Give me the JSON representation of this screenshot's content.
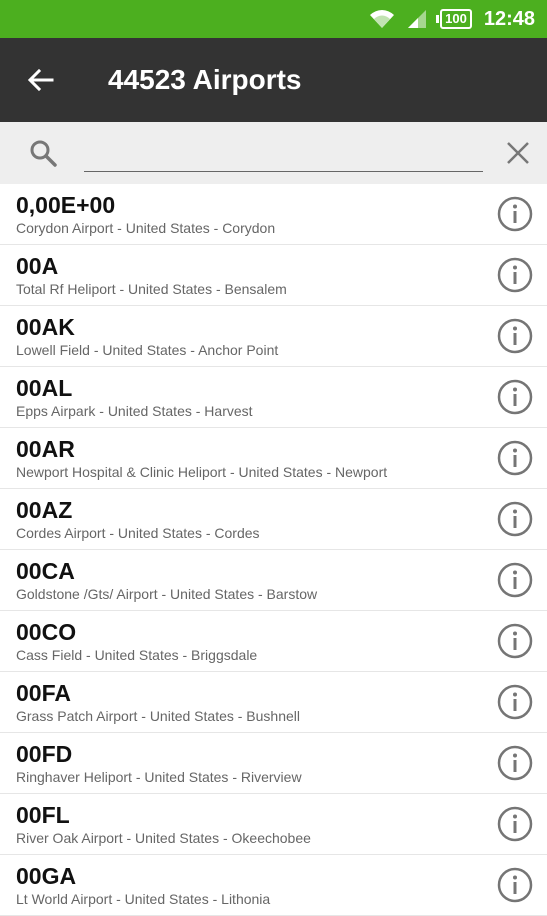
{
  "status_bar": {
    "battery": "100",
    "time": "12:48"
  },
  "toolbar": {
    "title": "44523 Airports"
  },
  "search": {
    "value": "",
    "placeholder": ""
  },
  "airports": [
    {
      "code": "0,00E+00",
      "desc": "Corydon Airport - United States - Corydon"
    },
    {
      "code": "00A",
      "desc": "Total Rf Heliport - United States - Bensalem"
    },
    {
      "code": "00AK",
      "desc": "Lowell Field - United States - Anchor Point"
    },
    {
      "code": "00AL",
      "desc": "Epps Airpark - United States - Harvest"
    },
    {
      "code": "00AR",
      "desc": "Newport Hospital & Clinic Heliport - United States - Newport"
    },
    {
      "code": "00AZ",
      "desc": "Cordes Airport - United States - Cordes"
    },
    {
      "code": "00CA",
      "desc": "Goldstone /Gts/ Airport - United States - Barstow"
    },
    {
      "code": "00CO",
      "desc": "Cass Field - United States - Briggsdale"
    },
    {
      "code": "00FA",
      "desc": "Grass Patch Airport - United States - Bushnell"
    },
    {
      "code": "00FD",
      "desc": "Ringhaver Heliport - United States - Riverview"
    },
    {
      "code": "00FL",
      "desc": "River Oak Airport - United States - Okeechobee"
    },
    {
      "code": "00GA",
      "desc": "Lt World Airport - United States - Lithonia"
    }
  ]
}
